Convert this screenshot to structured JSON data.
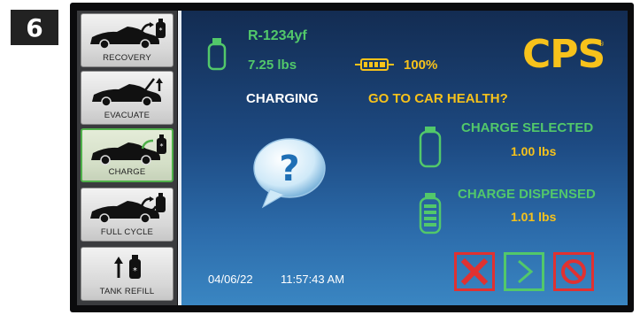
{
  "step_badge": "6",
  "sidebar": {
    "items": [
      {
        "label": "RECOVERY",
        "icon": "car-recovery-icon",
        "active": false
      },
      {
        "label": "EVACUATE",
        "icon": "car-evacuate-icon",
        "active": false
      },
      {
        "label": "CHARGE",
        "icon": "car-charge-icon",
        "active": true
      },
      {
        "label": "FULL CYCLE",
        "icon": "car-full-cycle-icon",
        "active": false
      },
      {
        "label": "TANK REFILL",
        "icon": "tank-refill-icon",
        "active": false
      }
    ]
  },
  "main": {
    "refrigerant": {
      "name": "R-1234yf",
      "weight": "7.25 lbs",
      "icon": "refrigerant-tank-icon"
    },
    "battery": {
      "level": "100%",
      "icon": "battery-icon"
    },
    "brand": {
      "logo_text": "CPS",
      "icon": "cps-logo"
    },
    "status_text": "CHARGING",
    "prompt": "GO TO CAR HEALTH?",
    "charge_selected": {
      "label": "CHARGE SELECTED",
      "value": "1.00 lbs",
      "icon": "empty-tank-icon"
    },
    "charge_dispensed": {
      "label": "CHARGE DISPENSED",
      "value": "1.01 lbs",
      "icon": "filled-tank-icon"
    },
    "help_icon": "question-bubble-icon",
    "date": "04/06/22",
    "time": "11:57:43 AM",
    "controls": {
      "cancel": "x-icon",
      "next": "chevron-right-icon",
      "stop": "prohibit-icon"
    }
  },
  "colors": {
    "accent_green": "#52c86a",
    "accent_yellow": "#f7c21b",
    "accent_red": "#e03131",
    "background_top": "#132c52",
    "background_bottom": "#3a86c2"
  }
}
